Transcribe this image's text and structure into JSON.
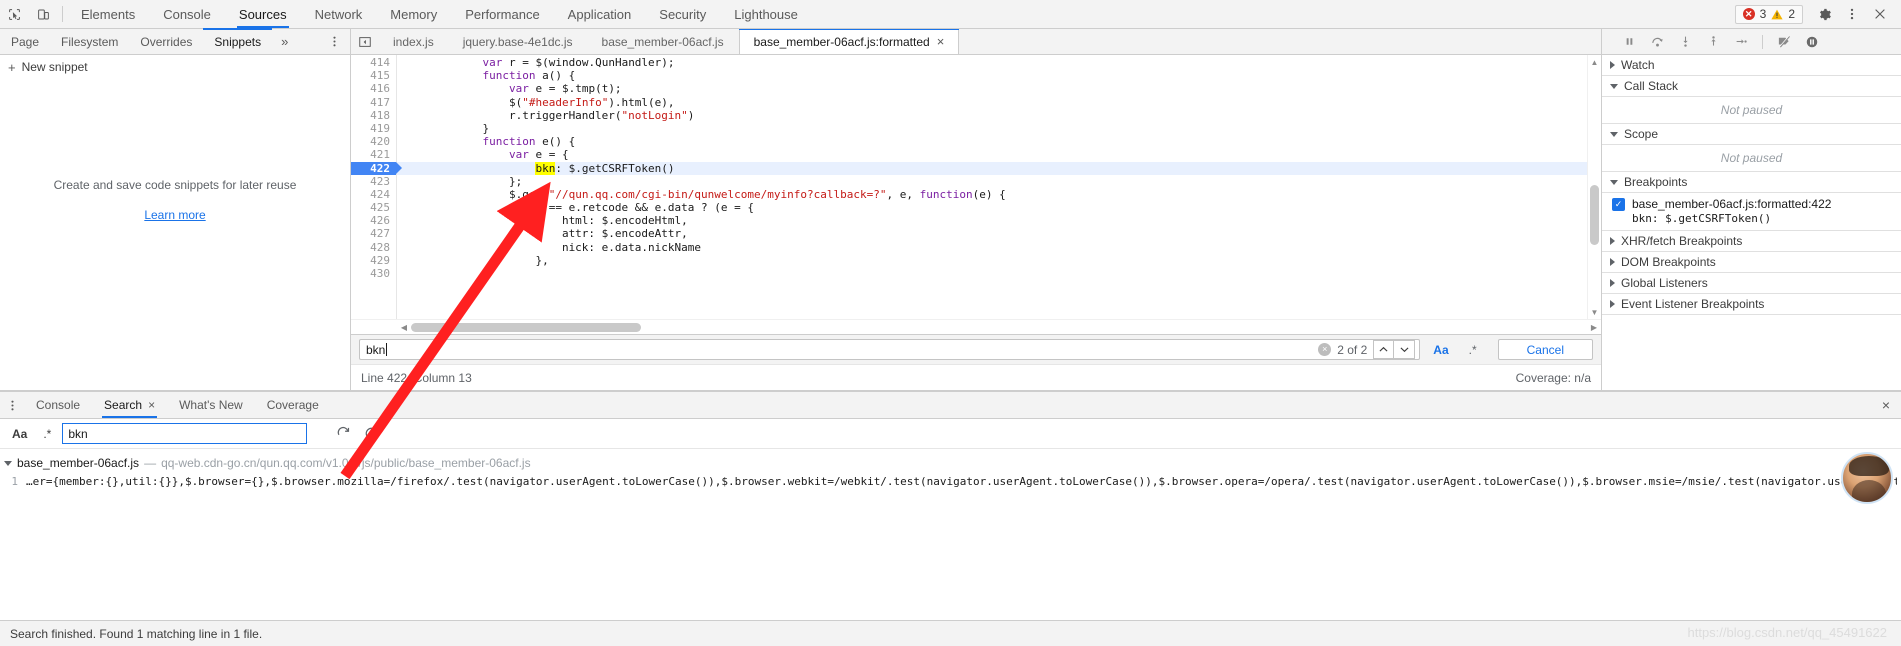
{
  "topbar": {
    "inspect_icon": "inspect-cursor-icon",
    "device_icon": "device-toolbar-icon",
    "tabs": [
      {
        "label": "Elements",
        "active": false
      },
      {
        "label": "Console",
        "active": false
      },
      {
        "label": "Sources",
        "active": true
      },
      {
        "label": "Network",
        "active": false
      },
      {
        "label": "Memory",
        "active": false
      },
      {
        "label": "Performance",
        "active": false
      },
      {
        "label": "Application",
        "active": false
      },
      {
        "label": "Security",
        "active": false
      },
      {
        "label": "Lighthouse",
        "active": false
      }
    ],
    "error_count": "3",
    "warning_count": "2",
    "settings_icon": "gear-icon",
    "more_icon": "kebab-menu-icon",
    "close_icon": "close-icon"
  },
  "navigator": {
    "tabs": [
      {
        "label": "Page",
        "active": false
      },
      {
        "label": "Filesystem",
        "active": false
      },
      {
        "label": "Overrides",
        "active": false
      },
      {
        "label": "Snippets",
        "active": true
      }
    ],
    "more_tabs": "»",
    "kebab": "⋮",
    "new_snippet_label": "New snippet",
    "new_snippet_plus": "+",
    "empty_text": "Create and save code snippets for later reuse",
    "learn_more": "Learn more"
  },
  "editor_tabs": {
    "scroll_icon": "tab-list-icon",
    "items": [
      {
        "label": "index.js",
        "active": false,
        "closable": false
      },
      {
        "label": "jquery.base-4e1dc.js",
        "active": false,
        "closable": false
      },
      {
        "label": "base_member-06acf.js",
        "active": false,
        "closable": false
      },
      {
        "label": "base_member-06acf.js:formatted",
        "active": true,
        "closable": true
      }
    ],
    "close_glyph": "×"
  },
  "debugger_toolbar": {
    "buttons": [
      {
        "name": "pause-resume-button",
        "glyph": "pause"
      },
      {
        "name": "step-over-button",
        "glyph": "step-over"
      },
      {
        "name": "step-into-button",
        "glyph": "step-into"
      },
      {
        "name": "step-out-button",
        "glyph": "step-out"
      },
      {
        "name": "step-button",
        "glyph": "step"
      },
      {
        "name": "deactivate-breakpoints-button",
        "glyph": "deactivate"
      },
      {
        "name": "pause-on-exceptions-button",
        "glyph": "pause-exceptions"
      }
    ]
  },
  "code": {
    "lines": [
      {
        "num": "414",
        "highlight": false,
        "breakpoint": false,
        "clipped": true,
        "tokens": [
          {
            "t": "            ",
            "c": "plain"
          },
          {
            "t": "var",
            "c": "kw"
          },
          {
            "t": " r = $(window.QunHandler);",
            "c": "plain"
          }
        ]
      },
      {
        "num": "415",
        "highlight": false,
        "breakpoint": false,
        "tokens": [
          {
            "t": "            ",
            "c": "plain"
          },
          {
            "t": "function",
            "c": "kw"
          },
          {
            "t": " a() {",
            "c": "plain"
          }
        ]
      },
      {
        "num": "416",
        "highlight": false,
        "breakpoint": false,
        "tokens": [
          {
            "t": "                ",
            "c": "plain"
          },
          {
            "t": "var",
            "c": "kw"
          },
          {
            "t": " e = $.tmp(t);",
            "c": "plain"
          }
        ]
      },
      {
        "num": "417",
        "highlight": false,
        "breakpoint": false,
        "tokens": [
          {
            "t": "                $(",
            "c": "plain"
          },
          {
            "t": "\"#headerInfo\"",
            "c": "str"
          },
          {
            "t": ").html(e),",
            "c": "plain"
          }
        ]
      },
      {
        "num": "418",
        "highlight": false,
        "breakpoint": false,
        "tokens": [
          {
            "t": "                r.triggerHandler(",
            "c": "plain"
          },
          {
            "t": "\"notLogin\"",
            "c": "str"
          },
          {
            "t": ")",
            "c": "plain"
          }
        ]
      },
      {
        "num": "419",
        "highlight": false,
        "breakpoint": false,
        "tokens": [
          {
            "t": "            }",
            "c": "plain"
          }
        ]
      },
      {
        "num": "420",
        "highlight": false,
        "breakpoint": false,
        "tokens": [
          {
            "t": "            ",
            "c": "plain"
          },
          {
            "t": "function",
            "c": "kw"
          },
          {
            "t": " e() {",
            "c": "plain"
          }
        ]
      },
      {
        "num": "421",
        "highlight": false,
        "breakpoint": false,
        "tokens": [
          {
            "t": "                ",
            "c": "plain"
          },
          {
            "t": "var",
            "c": "kw"
          },
          {
            "t": " e = {",
            "c": "plain"
          }
        ]
      },
      {
        "num": "422",
        "highlight": true,
        "breakpoint": true,
        "tokens": [
          {
            "t": "                    ",
            "c": "plain"
          },
          {
            "t": "bkn",
            "c": "mark"
          },
          {
            "t": ": $.getCSRFToken()",
            "c": "plain"
          }
        ]
      },
      {
        "num": "423",
        "highlight": false,
        "breakpoint": false,
        "tokens": [
          {
            "t": "                };",
            "c": "plain"
          }
        ]
      },
      {
        "num": "424",
        "highlight": false,
        "breakpoint": false,
        "tokens": [
          {
            "t": "                $.get(",
            "c": "plain"
          },
          {
            "t": "\"//qun.qq.com/cgi-bin/qunwelcome/myinfo?callback=?\"",
            "c": "str"
          },
          {
            "t": ", e, ",
            "c": "plain"
          },
          {
            "t": "function",
            "c": "kw"
          },
          {
            "t": "(e) {",
            "c": "plain"
          }
        ]
      },
      {
        "num": "425",
        "highlight": false,
        "breakpoint": false,
        "tokens": [
          {
            "t": "                    ",
            "c": "plain"
          },
          {
            "t": "0",
            "c": "num"
          },
          {
            "t": " == e.retcode && e.data ? (e = {",
            "c": "plain"
          }
        ]
      },
      {
        "num": "426",
        "highlight": false,
        "breakpoint": false,
        "tokens": [
          {
            "t": "                        html: $.encodeHtml,",
            "c": "plain"
          }
        ]
      },
      {
        "num": "427",
        "highlight": false,
        "breakpoint": false,
        "tokens": [
          {
            "t": "                        attr: $.encodeAttr,",
            "c": "plain"
          }
        ]
      },
      {
        "num": "428",
        "highlight": false,
        "breakpoint": false,
        "tokens": [
          {
            "t": "                        nick: e.data.nickName",
            "c": "plain"
          }
        ]
      },
      {
        "num": "429",
        "highlight": false,
        "breakpoint": false,
        "tokens": [
          {
            "t": "                    },",
            "c": "plain"
          }
        ]
      },
      {
        "num": "430",
        "highlight": false,
        "breakpoint": false,
        "clipped": true,
        "tokens": [
          {
            "t": "",
            "c": "plain"
          }
        ]
      }
    ]
  },
  "findbar": {
    "query": "bkn",
    "clear_glyph": "×",
    "match_count": "2 of 2",
    "prev_glyph": "∧",
    "next_glyph": "∨",
    "case_label": "Aa",
    "regex_label": ".*",
    "cancel_label": "Cancel"
  },
  "editor_status": {
    "position": "Line 422, Column 13",
    "coverage": "Coverage: n/a"
  },
  "right_panel": {
    "sections": [
      {
        "name": "watch",
        "title": "Watch",
        "expanded": false,
        "body": null
      },
      {
        "name": "call-stack",
        "title": "Call Stack",
        "expanded": true,
        "body": "Not paused"
      },
      {
        "name": "scope",
        "title": "Scope",
        "expanded": true,
        "body": "Not paused"
      },
      {
        "name": "breakpoints",
        "title": "Breakpoints",
        "expanded": true,
        "body": null
      }
    ],
    "breakpoint": {
      "checked": true,
      "check_glyph": "✓",
      "location": "base_member-06acf.js:formatted:422",
      "snippet": "bkn: $.getCSRFToken()"
    },
    "collapsed_sections": [
      {
        "name": "xhr-fetch-breakpoints",
        "title": "XHR/fetch Breakpoints"
      },
      {
        "name": "dom-breakpoints",
        "title": "DOM Breakpoints"
      },
      {
        "name": "global-listeners",
        "title": "Global Listeners"
      },
      {
        "name": "event-listener-breakpoints",
        "title": "Event Listener Breakpoints"
      }
    ]
  },
  "drawer": {
    "kebab": "⋮",
    "tabs": [
      {
        "label": "Console",
        "active": false,
        "closable": false
      },
      {
        "label": "Search",
        "active": true,
        "closable": true
      },
      {
        "label": "What's New",
        "active": false,
        "closable": false
      },
      {
        "label": "Coverage",
        "active": false,
        "closable": false
      }
    ],
    "close_glyph": "×",
    "drawer_close": "×",
    "search": {
      "case_label": "Aa",
      "regex_label": ".*",
      "query": "bkn",
      "placeholder": "",
      "refresh_icon": "refresh-icon",
      "clear_icon": "clear-icon"
    },
    "results": {
      "file_name": "base_member-06acf.js",
      "file_dash": "—",
      "file_url": "qq-web.cdn-go.cn/qun.qq.com/v1.0.0/js/public/base_member-06acf.js",
      "matches": [
        {
          "line": "1",
          "text": "…er={member:{},util:{}},$.browser={},$.browser.mozilla=/firefox/.test(navigator.userAgent.toLowerCase()),$.browser.webkit=/webkit/.test(navigator.userAgent.toLowerCase()),$.browser.opera=/opera/.test(navigator.userAgent.toLowerCase()),$.browser.msie=/msie/.test(navigator.userAgent.toLowerCase());var v"
        }
      ]
    }
  },
  "statusbar": {
    "message": "Search finished. Found 1 matching line in 1 file.",
    "watermark": "https://blog.csdn.net/qq_45491622"
  },
  "colors": {
    "accent": "#1a73e8",
    "breakpoint": "#4285f4",
    "highlight_line": "#e8f0fe",
    "search_mark": "#ffff00",
    "error": "#d93025",
    "warning": "#f5b400",
    "arrow": "#ff2020"
  }
}
